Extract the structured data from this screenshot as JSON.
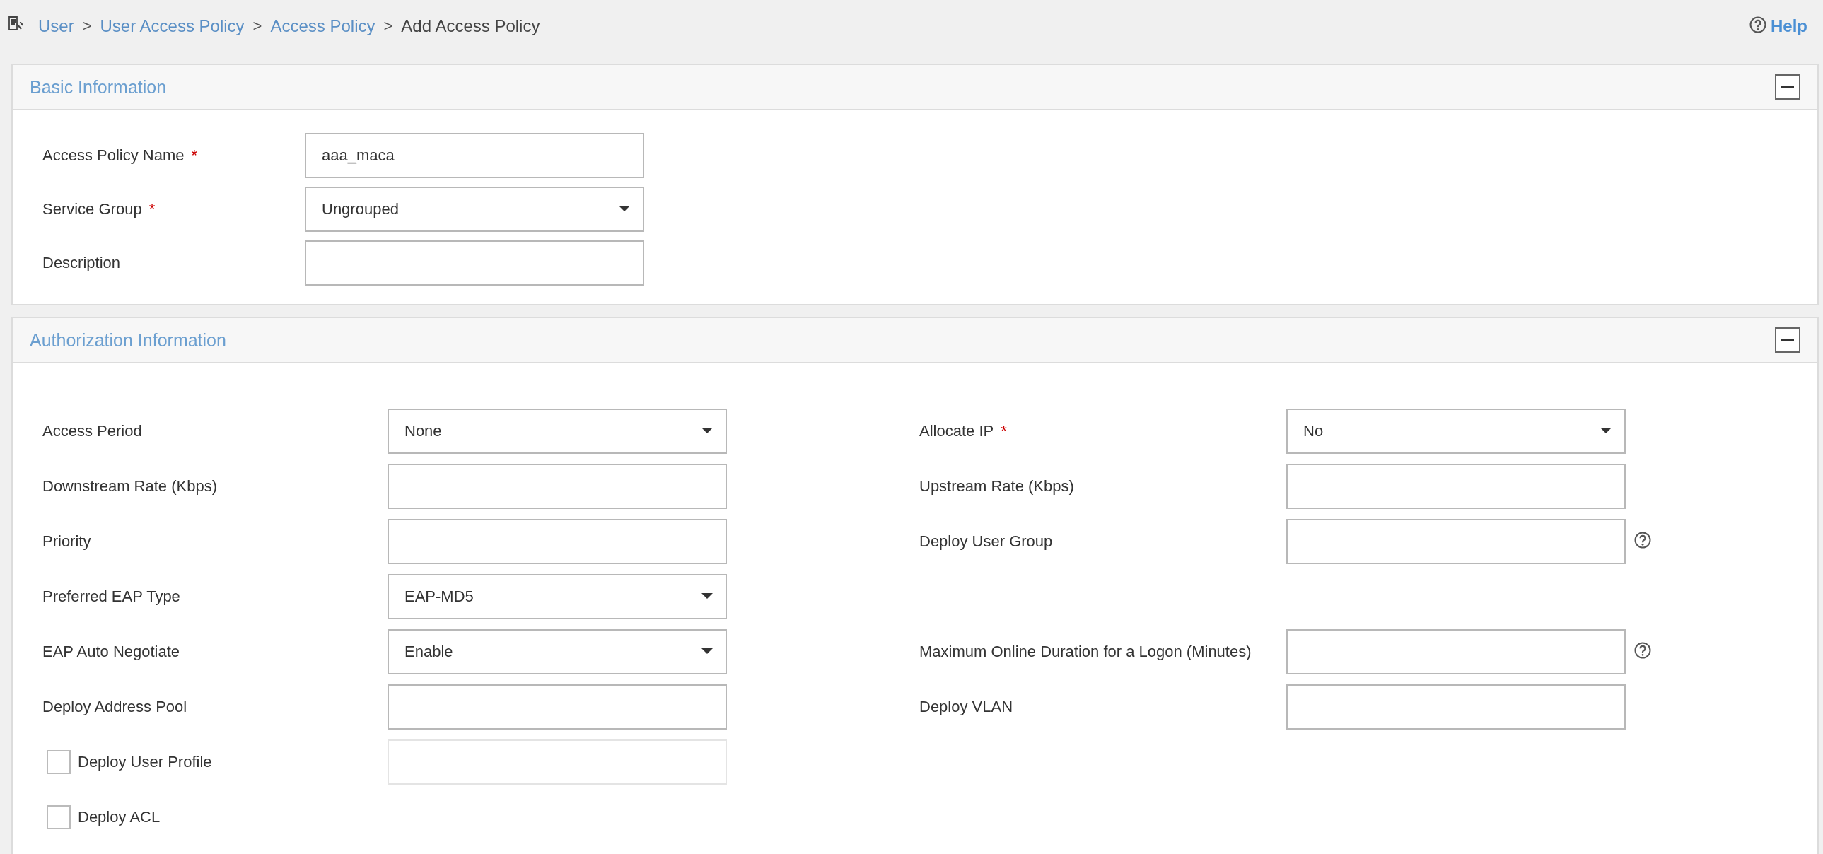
{
  "breadcrumb": [
    {
      "label": "User",
      "link": true
    },
    {
      "separator": ">",
      "label": "User Access Policy",
      "link": true
    },
    {
      "separator": ">",
      "label": "Access Policy",
      "link": true
    },
    {
      "separator": ">",
      "label": "Add Access Policy",
      "link": false
    }
  ],
  "help": {
    "label": "Help"
  },
  "sections": [
    {
      "title": "Basic Information",
      "expanded": true,
      "rows": [
        {
          "left": {
            "kind": "text",
            "label": "Access Policy Name",
            "marker": "*",
            "value": "aaa_maca"
          }
        },
        {
          "left": {
            "kind": "select",
            "label": "Service Group",
            "marker": "*",
            "value": "Ungrouped"
          }
        },
        {
          "left": {
            "kind": "text",
            "label": "Description"
          }
        }
      ]
    },
    {
      "title": "Authorization Information",
      "expanded": true,
      "rows": [
        {
          "left": {
            "kind": "select",
            "label": "Access Period",
            "value": "None"
          },
          "right": {
            "kind": "select",
            "label": "Allocate IP",
            "marker": "*",
            "value": "No"
          }
        },
        {
          "left": {
            "kind": "text",
            "label": "Downstream Rate (Kbps)"
          },
          "right": {
            "kind": "text",
            "label": "Upstream Rate (Kbps)"
          }
        },
        {
          "left": {
            "kind": "text",
            "label": "Priority"
          },
          "right": {
            "kind": "text",
            "label": "Deploy User Group",
            "hint": true
          }
        },
        {
          "left": {
            "kind": "select",
            "label": "Preferred EAP Type",
            "value": "EAP-MD5"
          }
        },
        {
          "left": {
            "kind": "select",
            "label": "EAP Auto Negotiate",
            "value": "Enable"
          },
          "right": {
            "kind": "text",
            "label": "Maximum Online Duration for a Logon (Minutes)",
            "hint": true
          }
        },
        {
          "left": {
            "kind": "text",
            "label": "Deploy Address Pool"
          },
          "right": {
            "kind": "text",
            "label": "Deploy VLAN"
          }
        },
        {
          "left": {
            "kind": "checkbox",
            "label": "Deploy User Profile",
            "checked": false,
            "field": {
              "disabled": true
            }
          }
        },
        {
          "left": {
            "kind": "checkbox",
            "label": "Deploy ACL",
            "checked": false
          }
        }
      ]
    }
  ]
}
